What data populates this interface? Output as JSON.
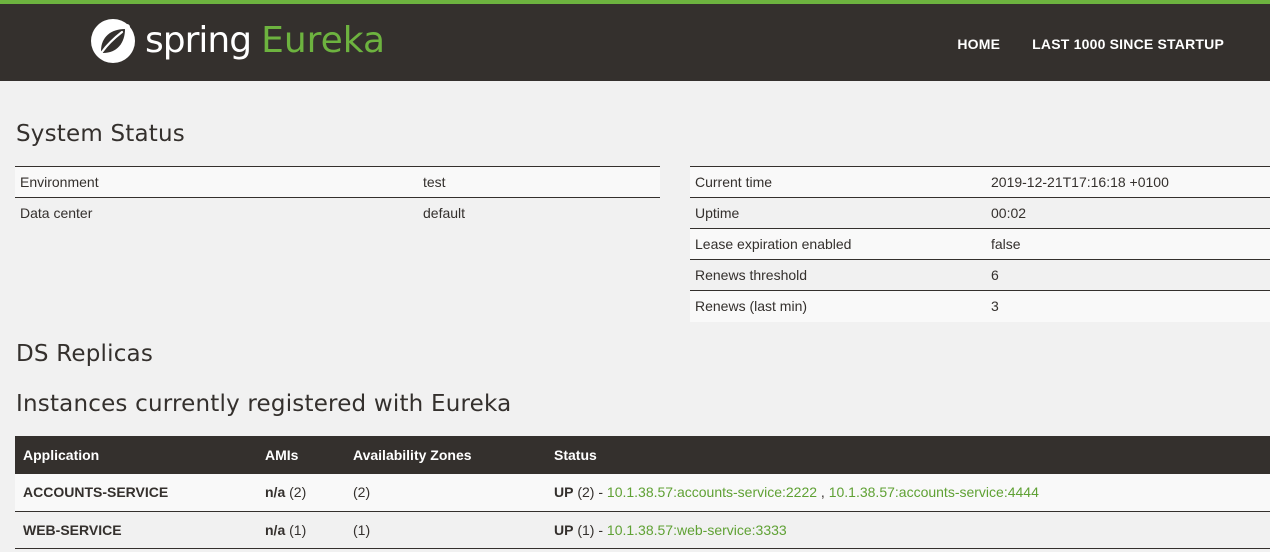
{
  "colors": {
    "header_bg": "#34302d",
    "accent": "#6db33f",
    "link": "#5fa134",
    "page_bg": "#f1f1f1"
  },
  "header": {
    "logo_icon": "spring-leaf-icon",
    "logo_spring": "spring",
    "logo_product": "Eureka",
    "nav": [
      {
        "label": "HOME"
      },
      {
        "label": "LAST 1000 SINCE STARTUP"
      }
    ]
  },
  "system_status": {
    "title": "System Status",
    "left_rows": [
      {
        "label": "Environment",
        "value": "test"
      },
      {
        "label": "Data center",
        "value": "default"
      }
    ],
    "right_rows": [
      {
        "label": "Current time",
        "value": "2019-12-21T17:16:18 +0100"
      },
      {
        "label": "Uptime",
        "value": "00:02"
      },
      {
        "label": "Lease expiration enabled",
        "value": "false"
      },
      {
        "label": "Renews threshold",
        "value": "6"
      },
      {
        "label": "Renews (last min)",
        "value": "3"
      }
    ]
  },
  "ds_replicas": {
    "title": "DS Replicas"
  },
  "instances": {
    "title": "Instances currently registered with Eureka",
    "columns": [
      "Application",
      "AMIs",
      "Availability Zones",
      "Status"
    ],
    "rows": [
      {
        "application": "ACCOUNTS-SERVICE",
        "amis_bold": "n/a",
        "amis_count": " (2)",
        "zones": "(2)",
        "status_bold": "UP",
        "status_count": " (2) - ",
        "links": [
          "10.1.38.57:accounts-service:2222",
          "10.1.38.57:accounts-service:4444"
        ],
        "separator": " , "
      },
      {
        "application": "WEB-SERVICE",
        "amis_bold": "n/a",
        "amis_count": " (1)",
        "zones": "(1)",
        "status_bold": "UP",
        "status_count": " (1) - ",
        "links": [
          "10.1.38.57:web-service:3333"
        ]
      }
    ]
  }
}
